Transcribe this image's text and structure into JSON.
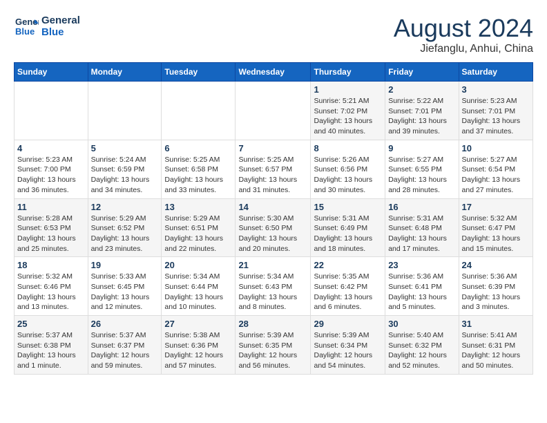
{
  "header": {
    "logo_line1": "General",
    "logo_line2": "Blue",
    "month": "August 2024",
    "location": "Jiefanglu, Anhui, China"
  },
  "weekdays": [
    "Sunday",
    "Monday",
    "Tuesday",
    "Wednesday",
    "Thursday",
    "Friday",
    "Saturday"
  ],
  "weeks": [
    [
      {
        "day": "",
        "info": ""
      },
      {
        "day": "",
        "info": ""
      },
      {
        "day": "",
        "info": ""
      },
      {
        "day": "",
        "info": ""
      },
      {
        "day": "1",
        "info": "Sunrise: 5:21 AM\nSunset: 7:02 PM\nDaylight: 13 hours\nand 40 minutes."
      },
      {
        "day": "2",
        "info": "Sunrise: 5:22 AM\nSunset: 7:01 PM\nDaylight: 13 hours\nand 39 minutes."
      },
      {
        "day": "3",
        "info": "Sunrise: 5:23 AM\nSunset: 7:01 PM\nDaylight: 13 hours\nand 37 minutes."
      }
    ],
    [
      {
        "day": "4",
        "info": "Sunrise: 5:23 AM\nSunset: 7:00 PM\nDaylight: 13 hours\nand 36 minutes."
      },
      {
        "day": "5",
        "info": "Sunrise: 5:24 AM\nSunset: 6:59 PM\nDaylight: 13 hours\nand 34 minutes."
      },
      {
        "day": "6",
        "info": "Sunrise: 5:25 AM\nSunset: 6:58 PM\nDaylight: 13 hours\nand 33 minutes."
      },
      {
        "day": "7",
        "info": "Sunrise: 5:25 AM\nSunset: 6:57 PM\nDaylight: 13 hours\nand 31 minutes."
      },
      {
        "day": "8",
        "info": "Sunrise: 5:26 AM\nSunset: 6:56 PM\nDaylight: 13 hours\nand 30 minutes."
      },
      {
        "day": "9",
        "info": "Sunrise: 5:27 AM\nSunset: 6:55 PM\nDaylight: 13 hours\nand 28 minutes."
      },
      {
        "day": "10",
        "info": "Sunrise: 5:27 AM\nSunset: 6:54 PM\nDaylight: 13 hours\nand 27 minutes."
      }
    ],
    [
      {
        "day": "11",
        "info": "Sunrise: 5:28 AM\nSunset: 6:53 PM\nDaylight: 13 hours\nand 25 minutes."
      },
      {
        "day": "12",
        "info": "Sunrise: 5:29 AM\nSunset: 6:52 PM\nDaylight: 13 hours\nand 23 minutes."
      },
      {
        "day": "13",
        "info": "Sunrise: 5:29 AM\nSunset: 6:51 PM\nDaylight: 13 hours\nand 22 minutes."
      },
      {
        "day": "14",
        "info": "Sunrise: 5:30 AM\nSunset: 6:50 PM\nDaylight: 13 hours\nand 20 minutes."
      },
      {
        "day": "15",
        "info": "Sunrise: 5:31 AM\nSunset: 6:49 PM\nDaylight: 13 hours\nand 18 minutes."
      },
      {
        "day": "16",
        "info": "Sunrise: 5:31 AM\nSunset: 6:48 PM\nDaylight: 13 hours\nand 17 minutes."
      },
      {
        "day": "17",
        "info": "Sunrise: 5:32 AM\nSunset: 6:47 PM\nDaylight: 13 hours\nand 15 minutes."
      }
    ],
    [
      {
        "day": "18",
        "info": "Sunrise: 5:32 AM\nSunset: 6:46 PM\nDaylight: 13 hours\nand 13 minutes."
      },
      {
        "day": "19",
        "info": "Sunrise: 5:33 AM\nSunset: 6:45 PM\nDaylight: 13 hours\nand 12 minutes."
      },
      {
        "day": "20",
        "info": "Sunrise: 5:34 AM\nSunset: 6:44 PM\nDaylight: 13 hours\nand 10 minutes."
      },
      {
        "day": "21",
        "info": "Sunrise: 5:34 AM\nSunset: 6:43 PM\nDaylight: 13 hours\nand 8 minutes."
      },
      {
        "day": "22",
        "info": "Sunrise: 5:35 AM\nSunset: 6:42 PM\nDaylight: 13 hours\nand 6 minutes."
      },
      {
        "day": "23",
        "info": "Sunrise: 5:36 AM\nSunset: 6:41 PM\nDaylight: 13 hours\nand 5 minutes."
      },
      {
        "day": "24",
        "info": "Sunrise: 5:36 AM\nSunset: 6:39 PM\nDaylight: 13 hours\nand 3 minutes."
      }
    ],
    [
      {
        "day": "25",
        "info": "Sunrise: 5:37 AM\nSunset: 6:38 PM\nDaylight: 13 hours\nand 1 minute."
      },
      {
        "day": "26",
        "info": "Sunrise: 5:37 AM\nSunset: 6:37 PM\nDaylight: 12 hours\nand 59 minutes."
      },
      {
        "day": "27",
        "info": "Sunrise: 5:38 AM\nSunset: 6:36 PM\nDaylight: 12 hours\nand 57 minutes."
      },
      {
        "day": "28",
        "info": "Sunrise: 5:39 AM\nSunset: 6:35 PM\nDaylight: 12 hours\nand 56 minutes."
      },
      {
        "day": "29",
        "info": "Sunrise: 5:39 AM\nSunset: 6:34 PM\nDaylight: 12 hours\nand 54 minutes."
      },
      {
        "day": "30",
        "info": "Sunrise: 5:40 AM\nSunset: 6:32 PM\nDaylight: 12 hours\nand 52 minutes."
      },
      {
        "day": "31",
        "info": "Sunrise: 5:41 AM\nSunset: 6:31 PM\nDaylight: 12 hours\nand 50 minutes."
      }
    ]
  ]
}
